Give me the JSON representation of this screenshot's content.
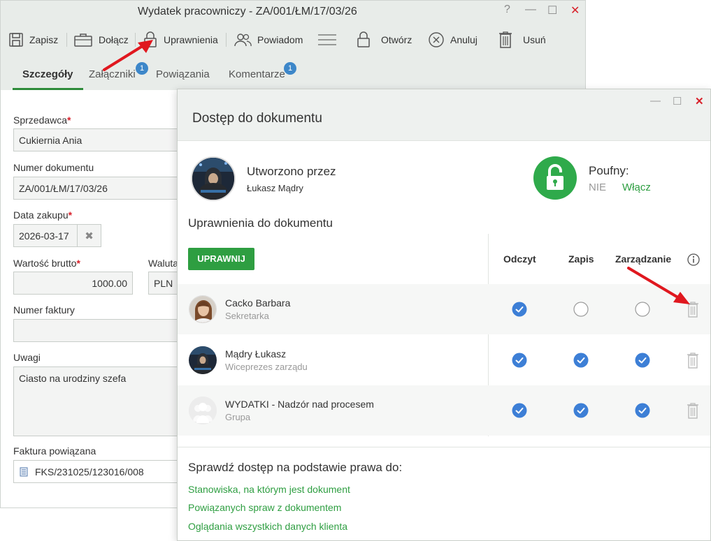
{
  "window": {
    "title": "Wydatek pracowniczy - ZA/001/ŁM/17/03/26",
    "help": "?",
    "minimize": "—",
    "maximize": "☐",
    "close": "✕"
  },
  "toolbar": {
    "save": "Zapisz",
    "attach": "Dołącz",
    "permissions": "Uprawnienia",
    "notify": "Powiadom",
    "open": "Otwórz",
    "cancel": "Anuluj",
    "delete": "Usuń"
  },
  "tabs": [
    {
      "label": "Szczegóły",
      "badge": ""
    },
    {
      "label": "Załączniki",
      "badge": "1"
    },
    {
      "label": "Powiązania",
      "badge": ""
    },
    {
      "label": "Komentarze",
      "badge": "1"
    }
  ],
  "form": {
    "seller": {
      "label": "Sprzedawca",
      "value": "Cukiernia Ania"
    },
    "doc_number": {
      "label": "Numer dokumentu",
      "value": "ZA/001/ŁM/17/03/26"
    },
    "purchase_date": {
      "label": "Data zakupu",
      "value": "2026-03-17"
    },
    "gross_value": {
      "label": "Wartość brutto",
      "value": "1000.00"
    },
    "currency": {
      "label": "Waluta",
      "value": "PLN"
    },
    "invoice_number": {
      "label": "Numer faktury",
      "value": ""
    },
    "notes": {
      "label": "Uwagi",
      "value": "Ciasto na urodziny szefa"
    },
    "linked_invoice": {
      "label": "Faktura powiązana",
      "value": "FKS/231025/123016/008"
    },
    "required_mark": "*"
  },
  "dialog": {
    "title": "Dostęp do dokumentu",
    "created_by_label": "Utworzono przez",
    "created_by_name": "Łukasz Mądry",
    "confidential_label": "Poufny:",
    "confidential_value": "NIE",
    "confidential_action": "Włącz",
    "permissions_title": "Uprawnienia do dokumentu",
    "grant_button": "UPRAWNIJ",
    "columns": [
      "Odczyt",
      "Zapis",
      "Zarządzanie"
    ],
    "rows": [
      {
        "name": "Cacko Barbara",
        "role": "Sekretarka",
        "read": true,
        "write": false,
        "manage": false
      },
      {
        "name": "Mądry Łukasz",
        "role": "Wiceprezes zarządu",
        "read": true,
        "write": true,
        "manage": true
      },
      {
        "name": "WYDATKI - Nadzór nad procesem",
        "role": "Grupa",
        "read": true,
        "write": true,
        "manage": true
      }
    ],
    "check_title": "Sprawdź dostęp na podstawie prawa do:",
    "links": [
      "Stanowiska, na którym jest dokument",
      "Powiązanych spraw z dokumentem",
      "Oglądania wszystkich danych klienta"
    ]
  },
  "colors": {
    "accent_green": "#2e9e41",
    "check_blue": "#3d7fd6",
    "badge_blue": "#3d87c9",
    "required_red": "#d8202a",
    "arrow_red": "#e0181f"
  }
}
